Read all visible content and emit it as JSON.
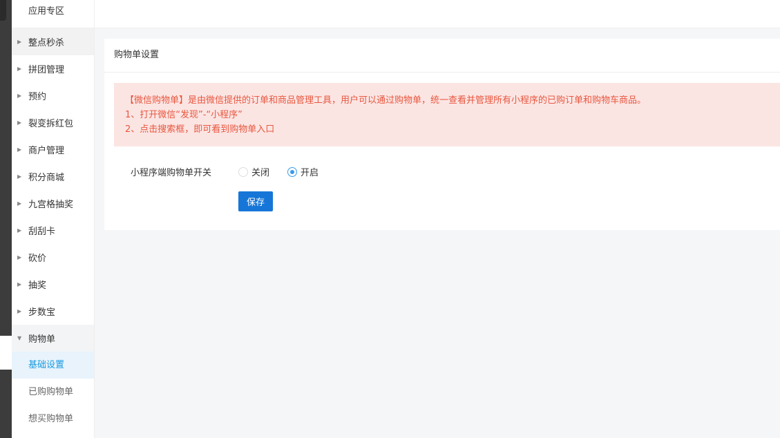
{
  "sidebar": {
    "top": "应用专区",
    "items": [
      {
        "label": "整点秒杀"
      },
      {
        "label": "拼团管理"
      },
      {
        "label": "预约"
      },
      {
        "label": "裂变拆红包"
      },
      {
        "label": "商户管理"
      },
      {
        "label": "积分商城"
      },
      {
        "label": "九宫格抽奖"
      },
      {
        "label": "刮刮卡"
      },
      {
        "label": "砍价"
      },
      {
        "label": "抽奖"
      },
      {
        "label": "步数宝"
      }
    ],
    "open": {
      "label": "购物单",
      "children": [
        {
          "label": "基础设置"
        },
        {
          "label": "已购购物单"
        },
        {
          "label": "想买购物单"
        }
      ]
    }
  },
  "card": {
    "title": "购物单设置",
    "alert": [
      "【微信购物单】是由微信提供的订单和商品管理工具，用户可以通过购物单，统一查看并管理所有小程序的已购订单和购物车商品。",
      "1、打开微信“发现”-“小程序”",
      "2、点击搜索框，即可看到购物单入口"
    ],
    "switch_label": "小程序端购物单开关",
    "options": [
      {
        "label": "关闭",
        "checked": false
      },
      {
        "label": "开启",
        "checked": true
      }
    ],
    "save": "保存"
  }
}
